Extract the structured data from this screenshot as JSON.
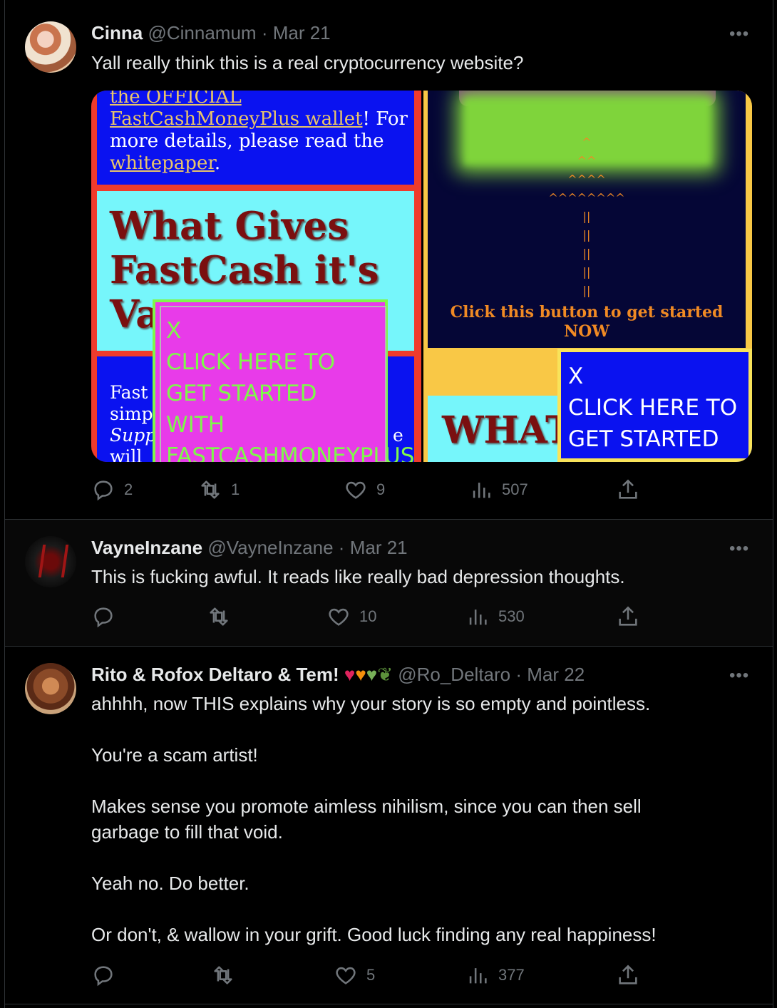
{
  "colors": {
    "background": "#000000",
    "text": "#e7e9ea",
    "muted": "#71767b",
    "border": "#2f3336"
  },
  "tweets": [
    {
      "name": "Cinna",
      "handle": "@Cinnamum",
      "date": "Mar 21",
      "text": "Yall really think this is a real cryptocurrency website?",
      "replies": "2",
      "retweets": "1",
      "likes": "9",
      "views": "507",
      "media": {
        "left": {
          "top_text_1": "the OFFICIAL",
          "top_link": "FastCashMoneyPlus wallet",
          "top_text_2": "! For",
          "top_text_3": "more details, please read the",
          "top_link_2": "whitepaper",
          "top_text_4": ".",
          "heading_1": "What Gives",
          "heading_2": "FastCash it's",
          "heading_3": "Va",
          "body_1": "Fast",
          "body_2": "simp",
          "body_3": "Supp",
          "body_4": "will",
          "body_5": "e",
          "popup_x": "X",
          "popup_lines": [
            "CLICK HERE TO",
            "GET STARTED",
            "WITH",
            "FASTCASHMONEYPLUS"
          ]
        },
        "right": {
          "arrows": [
            "^",
            "^^",
            "^^^^",
            "^^^^^^^^",
            "||",
            "||",
            "||",
            "||",
            "||"
          ],
          "cta_1": "Click this button to get started",
          "cta_2": "NOW",
          "heading": "WHAT",
          "popup_x": "X",
          "popup_lines": [
            "CLICK HERE TO",
            "GET STARTED"
          ]
        }
      }
    },
    {
      "name": "VayneInzane",
      "handle": "@VayneInzane",
      "date": "Mar 21",
      "text": "This is fucking awful. It reads like really bad depression thoughts.",
      "replies": "",
      "retweets": "",
      "likes": "10",
      "views": "530"
    },
    {
      "name": "Rito & Rofox Deltaro & Tem!",
      "handle": "@Ro_Deltaro",
      "date": "Mar 22",
      "text": "ahhhh, now THIS explains why your story is so empty and pointless.\n\nYou're a scam artist!\n\nMakes sense you promote aimless nihilism, since you can then sell\ngarbage to fill that void.\n\nYeah no. Do better.\n\nOr don't, & wallow in your grift. Good luck finding any real happiness!",
      "replies": "",
      "retweets": "",
      "likes": "5",
      "views": "377"
    }
  ],
  "separator": "·",
  "more_label": "•••"
}
